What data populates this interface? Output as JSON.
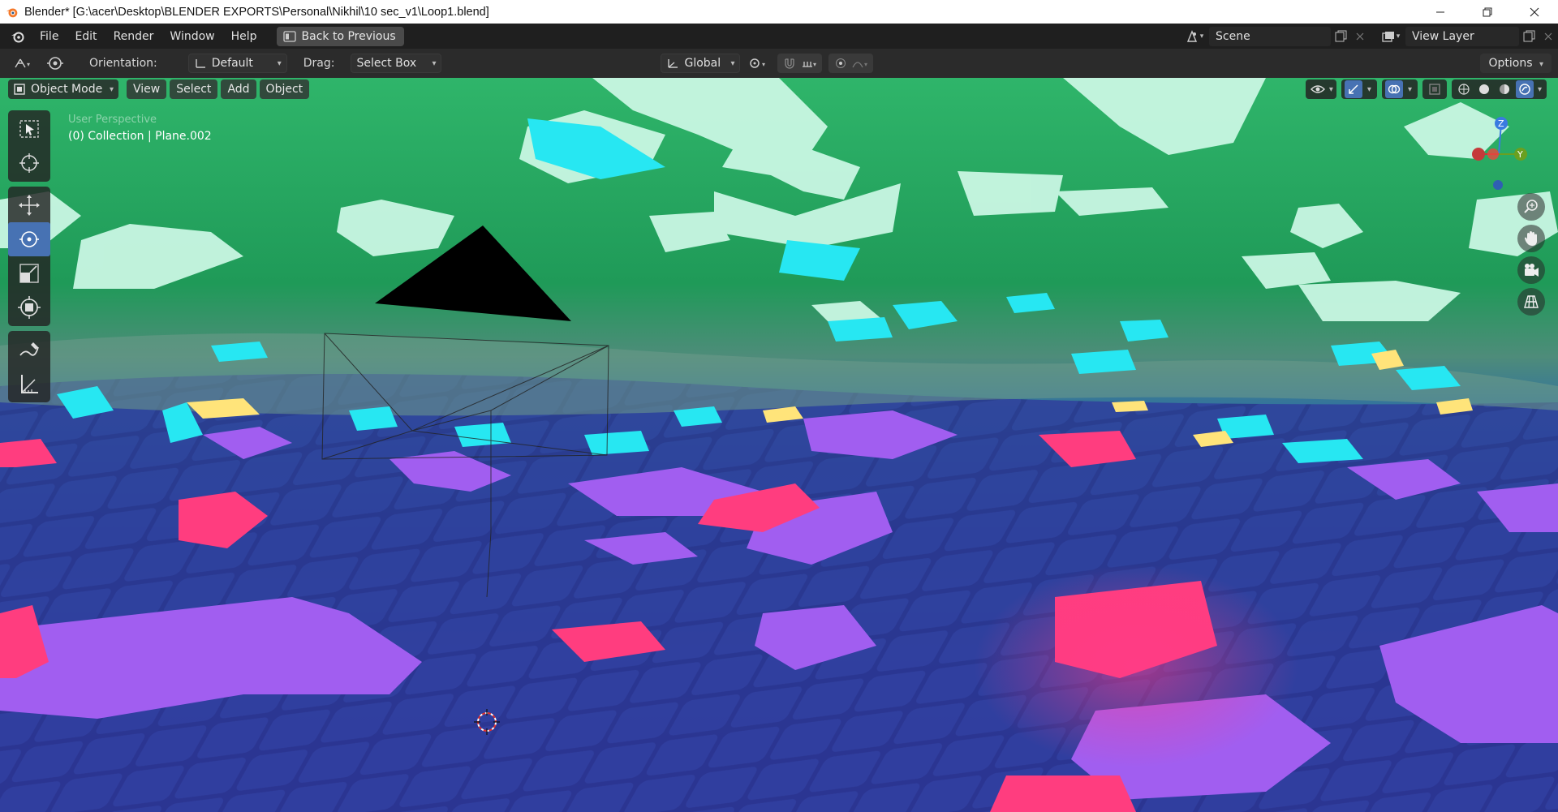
{
  "window": {
    "title": "Blender* [G:\\acer\\Desktop\\BLENDER EXPORTS\\Personal\\Nikhil\\10 sec_v1\\Loop1.blend]"
  },
  "menu": {
    "items": [
      "File",
      "Edit",
      "Render",
      "Window",
      "Help"
    ],
    "back_button": "Back to Previous"
  },
  "scene": {
    "name": "Scene",
    "view_layer": "View Layer"
  },
  "tool_settings": {
    "orientation_label": "Orientation:",
    "orientation_value": "Default",
    "drag_label": "Drag:",
    "drag_value": "Select Box",
    "transform_orientation": "Global",
    "options_label": "Options"
  },
  "viewport": {
    "mode": "Object Mode",
    "menus": [
      "View",
      "Select",
      "Add",
      "Object"
    ],
    "perspective_label": "User Perspective",
    "collection_info": "(0) Collection | Plane.002"
  },
  "gizmo": {
    "z_label": "Z",
    "y_label": "Y"
  },
  "colors": {
    "active_blue": "#4772b3",
    "titlebar_bg": "#ffffff",
    "menubar_bg": "#1f1f1f",
    "header_bg": "#2b2b2b"
  },
  "icons": {
    "tools": [
      "select-box-icon",
      "cursor-icon",
      "move-icon",
      "rotate-icon",
      "scale-icon",
      "transform-icon",
      "annotate-icon",
      "measure-icon"
    ],
    "nav": [
      "zoom-icon",
      "hand-pan-icon",
      "camera-view-icon",
      "grid-ortho-icon"
    ]
  }
}
